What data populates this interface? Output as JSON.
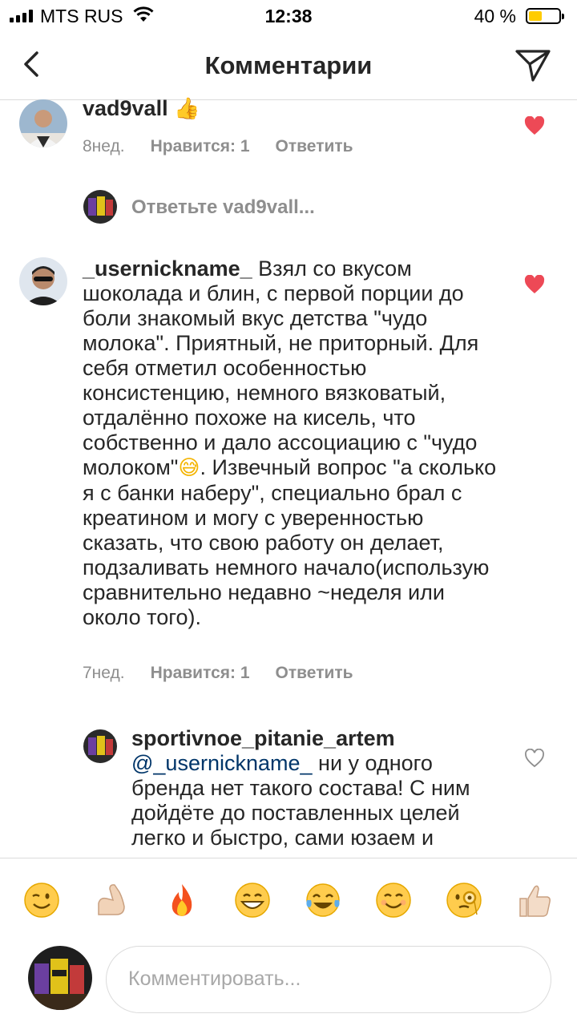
{
  "status_bar": {
    "carrier": "MTS RUS",
    "time": "12:38",
    "battery": "40 %"
  },
  "header": {
    "title": "Комментарии"
  },
  "comments": [
    {
      "username": "vad9vall",
      "text": "",
      "age": "8нед.",
      "likes": "Нравится: 1",
      "reply": "Ответить",
      "liked": true
    },
    {
      "username": "_usernickname_",
      "text": "Взял со вкусом шоколада и блин, с первой порции до боли знакомый вкус детства \"чудо молока\". Приятный, не приторный. Для себя отметил особенностью консистенцию, немного вязковатый, отдалённо похоже на кисель, что собственно и дало ассоциацию с \"чудо молоком\"",
      "text2": ". Извечный вопрос \"а сколько я с банки наберу\", специально брал с креатином и могу с уверенностью сказать, что свою работу он делает, подзаливать немного начало(использую сравнительно недавно ~неделя или около того).",
      "age": "7нед.",
      "likes": "Нравится: 1",
      "reply": "Ответить",
      "liked": true
    }
  ],
  "reply_prompt": "Ответьте vad9vall...",
  "reply_comment": {
    "username": "sportivnoe_pitanie_artem",
    "mention": "@_usernickname_",
    "text": "ни у одного бренда нет такого состава! С ним дойдёте до поставленных целей легко и быстро, сами юзаем и",
    "liked": false
  },
  "emoji_icons": [
    "winking-face",
    "flexed-biceps",
    "fire",
    "grinning-face",
    "tears-of-joy",
    "smiling-face",
    "face-with-monocle",
    "thumbs-up"
  ],
  "composer": {
    "placeholder": "Комментировать..."
  },
  "colors": {
    "heart": "#ed4956",
    "text": "#262626",
    "muted": "#8e8e8e",
    "mention": "#003569"
  }
}
